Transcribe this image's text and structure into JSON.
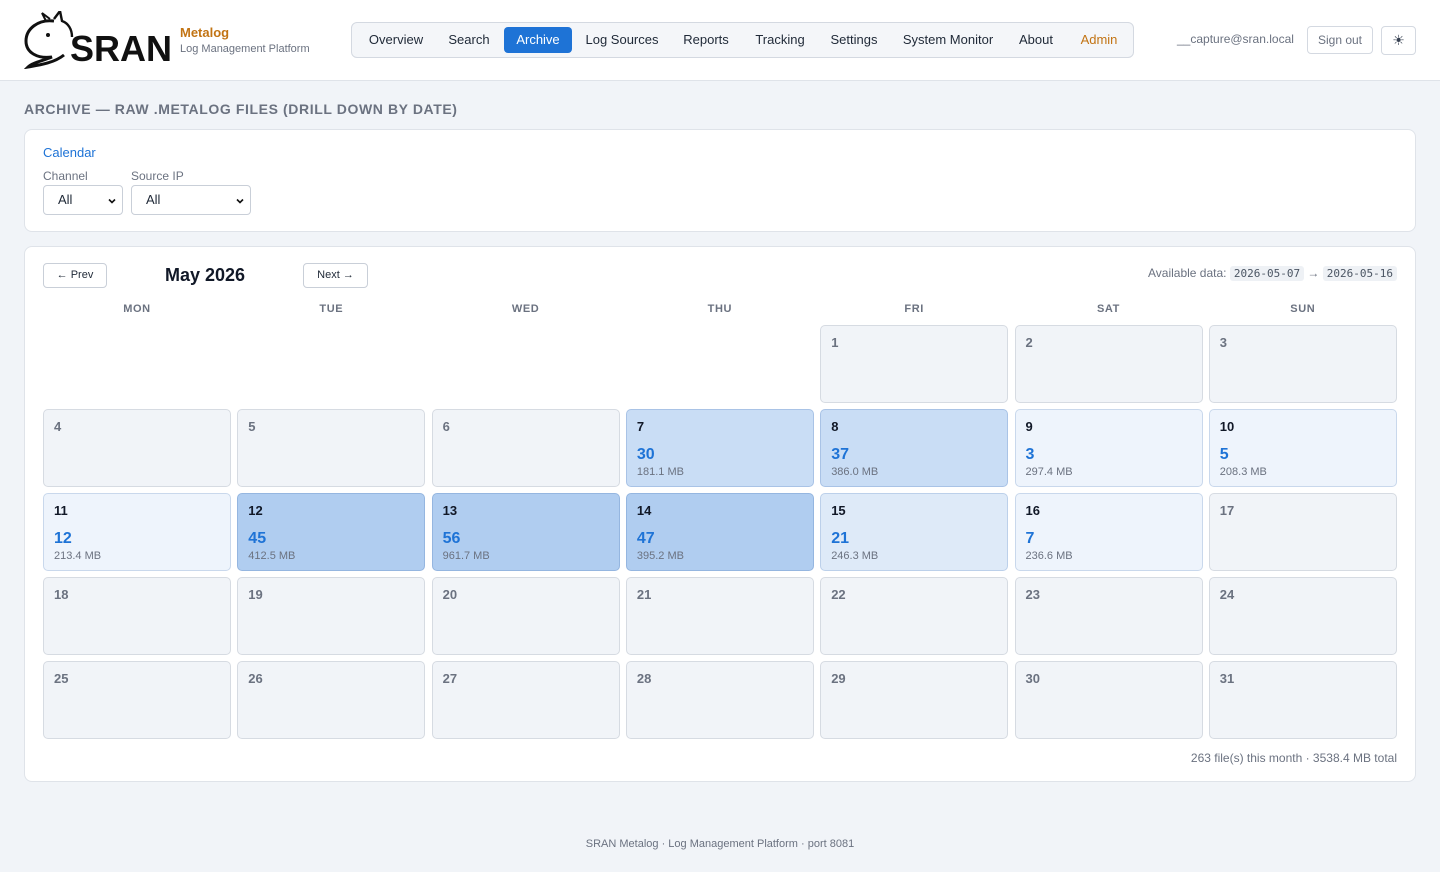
{
  "header": {
    "logo_text": "SRAN",
    "brand_name": "Metalog",
    "brand_subtitle": "Log Management Platform",
    "nav": [
      {
        "label": "Overview",
        "active": false
      },
      {
        "label": "Search",
        "active": false
      },
      {
        "label": "Archive",
        "active": true
      },
      {
        "label": "Log Sources",
        "active": false
      },
      {
        "label": "Reports",
        "active": false
      },
      {
        "label": "Tracking",
        "active": false
      },
      {
        "label": "Settings",
        "active": false
      },
      {
        "label": "System Monitor",
        "active": false
      },
      {
        "label": "About",
        "active": false
      },
      {
        "label": "Admin",
        "active": false
      }
    ],
    "user_email": "__capture@sran.local",
    "signout_label": "Sign out",
    "theme_icon": "sun-icon",
    "theme_glyph": "☀"
  },
  "page_title": "ARCHIVE — RAW .METALOG FILES (DRILL DOWN BY DATE)",
  "filters": {
    "calendar_link": "Calendar",
    "channel_label": "Channel",
    "channel_value": "All",
    "source_ip_label": "Source IP",
    "source_ip_value": "All"
  },
  "calendar": {
    "prev_label": "← Prev",
    "next_label": "Next →",
    "month_title": "May 2026",
    "available_label": "Available data:",
    "available_from": "2026-05-07",
    "available_arrow": "→",
    "available_to": "2026-05-16",
    "weekdays": [
      "MON",
      "TUE",
      "WED",
      "THU",
      "FRI",
      "SAT",
      "SUN"
    ],
    "first_weekday_index": 4,
    "days_in_month": 31,
    "data_days": {
      "7": {
        "count": "30",
        "size": "181.1 MB",
        "level": 3
      },
      "8": {
        "count": "37",
        "size": "386.0 MB",
        "level": 3
      },
      "9": {
        "count": "3",
        "size": "297.4 MB",
        "level": 1
      },
      "10": {
        "count": "5",
        "size": "208.3 MB",
        "level": 1
      },
      "11": {
        "count": "12",
        "size": "213.4 MB",
        "level": 1
      },
      "12": {
        "count": "45",
        "size": "412.5 MB",
        "level": 4
      },
      "13": {
        "count": "56",
        "size": "961.7 MB",
        "level": 4
      },
      "14": {
        "count": "47",
        "size": "395.2 MB",
        "level": 4
      },
      "15": {
        "count": "21",
        "size": "246.3 MB",
        "level": 2
      },
      "16": {
        "count": "7",
        "size": "236.6 MB",
        "level": 1
      }
    },
    "summary": "263 file(s) this month · 3538.4 MB total"
  },
  "footer": "SRAN Metalog · Log Management Platform · port 8081"
}
